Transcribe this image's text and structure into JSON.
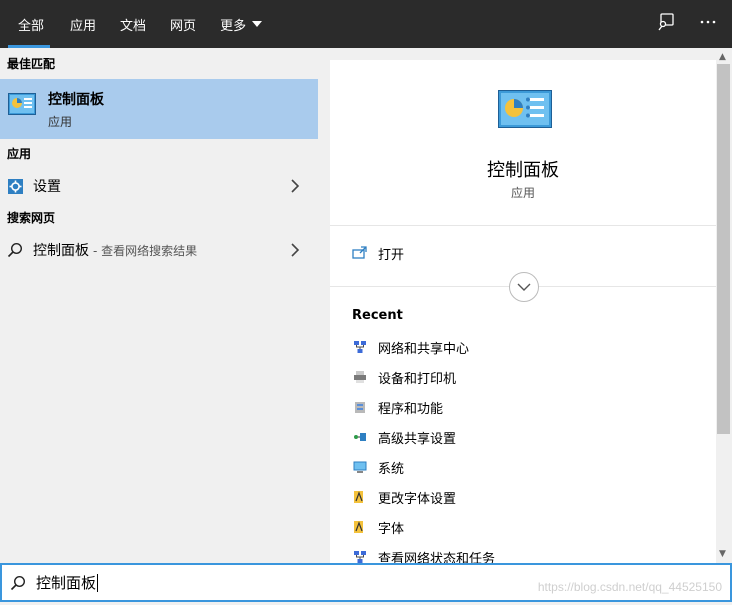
{
  "tabs": [
    {
      "label": "全部"
    },
    {
      "label": "应用"
    },
    {
      "label": "文档"
    },
    {
      "label": "网页"
    },
    {
      "label": "更多"
    }
  ],
  "top_icons": [
    "feedback-icon",
    "more-options-icon"
  ],
  "left": {
    "best_match_header": "最佳匹配",
    "best_match": {
      "title": "控制面板",
      "subtitle": "应用",
      "icon": "control-panel-icon"
    },
    "apps_header": "应用",
    "apps": [
      {
        "label": "设置",
        "icon": "settings-gear-icon"
      }
    ],
    "web_header": "搜索网页",
    "web": [
      {
        "label": "控制面板",
        "suffix": " - 查看网络搜索结果",
        "icon": "search-icon"
      }
    ]
  },
  "right": {
    "title": "控制面板",
    "subtitle": "应用",
    "open_label": "打开",
    "recent_header": "Recent",
    "recent": [
      {
        "label": "网络和共享中心",
        "icon": "network-icon"
      },
      {
        "label": "设备和打印机",
        "icon": "printer-icon"
      },
      {
        "label": "程序和功能",
        "icon": "programs-icon"
      },
      {
        "label": "高级共享设置",
        "icon": "sharing-icon"
      },
      {
        "label": "系统",
        "icon": "system-icon"
      },
      {
        "label": "更改字体设置",
        "icon": "font-icon"
      },
      {
        "label": "字体",
        "icon": "font-icon"
      },
      {
        "label": "查看网络状态和任务",
        "icon": "network-icon"
      }
    ]
  },
  "search": {
    "value": "控制面板"
  },
  "watermark": "https://blog.csdn.net/qq_44525150",
  "colors": {
    "topbar": "#2b2b2b",
    "accent": "#3a96dd",
    "selection": "#a9cbed"
  }
}
